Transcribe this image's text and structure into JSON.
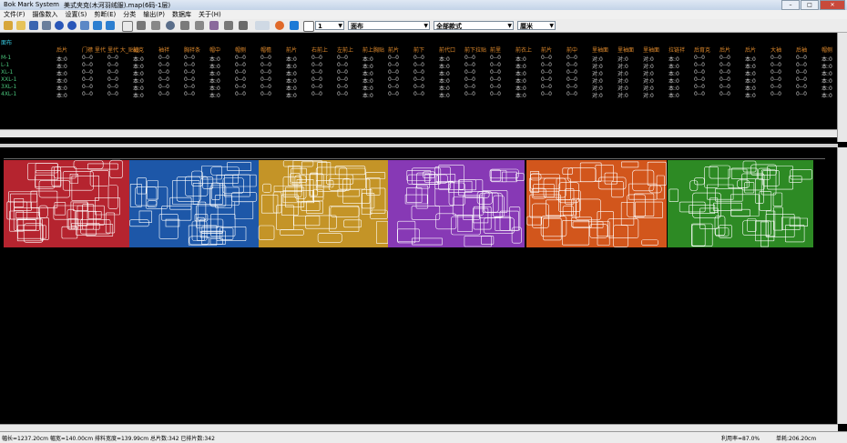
{
  "window": {
    "app_name": "Bok Mark System",
    "file_title": "美式夹克(木河羽绒服).map(6码-1层)",
    "minimize": "–",
    "maximize": "□",
    "close": "✕"
  },
  "menu": [
    "文件(F)",
    "摄像数入",
    "设置(S)",
    "剪断(E)",
    "分类",
    "输出(P)",
    "数据库",
    "关于(H)"
  ],
  "toolbar": {
    "layer_value": "1",
    "fabric_value": "面布",
    "style_value": "全部款式",
    "unit_value": "厘米"
  },
  "grid": {
    "top_label": "面布",
    "headers": [
      "后片",
      "门襟 里代",
      "里代 大_贴边",
      "袖克",
      "袖袢",
      "胸袢条",
      "帽中",
      "帽侧",
      "帽檐",
      "前片",
      "右前上",
      "左前上",
      "前上胸贴",
      "前片",
      "前下",
      "前代口",
      "前下拉贴",
      "前里",
      "前衣上",
      "前片",
      "前中",
      "里袖面",
      "里袖面",
      "里袖面",
      "拉链袢",
      "后育克",
      "后片",
      "后片",
      "大袖",
      "后袖",
      "帽侧",
      "帽内里_贴边"
    ],
    "rows": [
      {
        "size": "M-1",
        "c1": "本:0",
        "c2": "0--0",
        "c3": "0--0"
      },
      {
        "size": "L-1",
        "c1": "本:0",
        "c2": "0--0",
        "c3": "0--0"
      },
      {
        "size": "XL-1",
        "c1": "本:0",
        "c2": "0--0",
        "c3": "0--0"
      },
      {
        "size": "XXL-1",
        "c1": "本:0",
        "c2": "0--0",
        "c3": "0--0"
      },
      {
        "size": "3XL-1",
        "c1": "本:0",
        "c2": "0--0",
        "c3": "0--0"
      },
      {
        "size": "4XL-1",
        "c1": "本:0",
        "c2": "0--0",
        "c3": "0--0"
      }
    ],
    "selected_cell": "0--0",
    "pair_value": "对:0"
  },
  "canvas": {
    "colors": [
      "#b5242f",
      "#1d57a8",
      "#c49427",
      "#8739b5",
      "#d2561c",
      "#2d8a24"
    ]
  },
  "status": {
    "left": "幅长=1237.20cm 幅宽=140.00cm 排料宽度=139.99cm 总片数:342 已排片数:342",
    "usage": "利用率=87.0%",
    "unit_length": "单耗:206.20cm"
  }
}
